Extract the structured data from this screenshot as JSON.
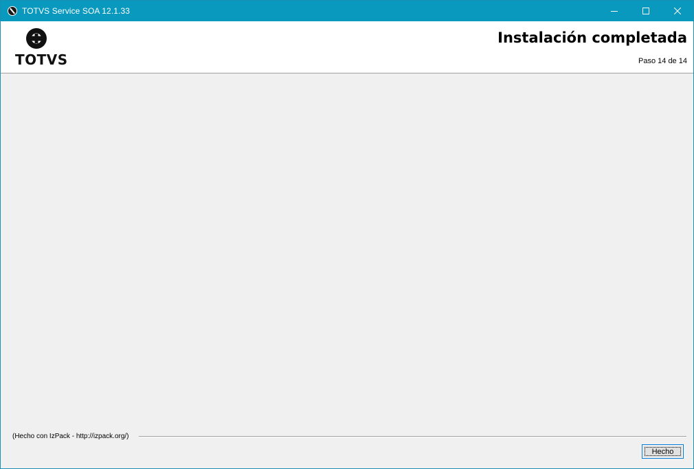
{
  "window": {
    "title": "TOTVS Service SOA 12.1.33",
    "icon": "totvs-app-icon",
    "controls": {
      "minimize": "minimize-icon",
      "maximize": "maximize-icon",
      "close": "close-icon"
    }
  },
  "header": {
    "logo_text": "TOTVS",
    "title": "Instalación completada",
    "step": {
      "prefix": "Paso",
      "current": "14",
      "separator": "de",
      "total": "14"
    }
  },
  "footer": {
    "credit": "(Hecho con IzPack - http://izpack.org/)",
    "done_label": "Hecho"
  },
  "colors": {
    "titlebar": "#0a99be",
    "panel": "#f0f0f0",
    "header": "#ffffff",
    "button_focus": "#0078d7"
  }
}
